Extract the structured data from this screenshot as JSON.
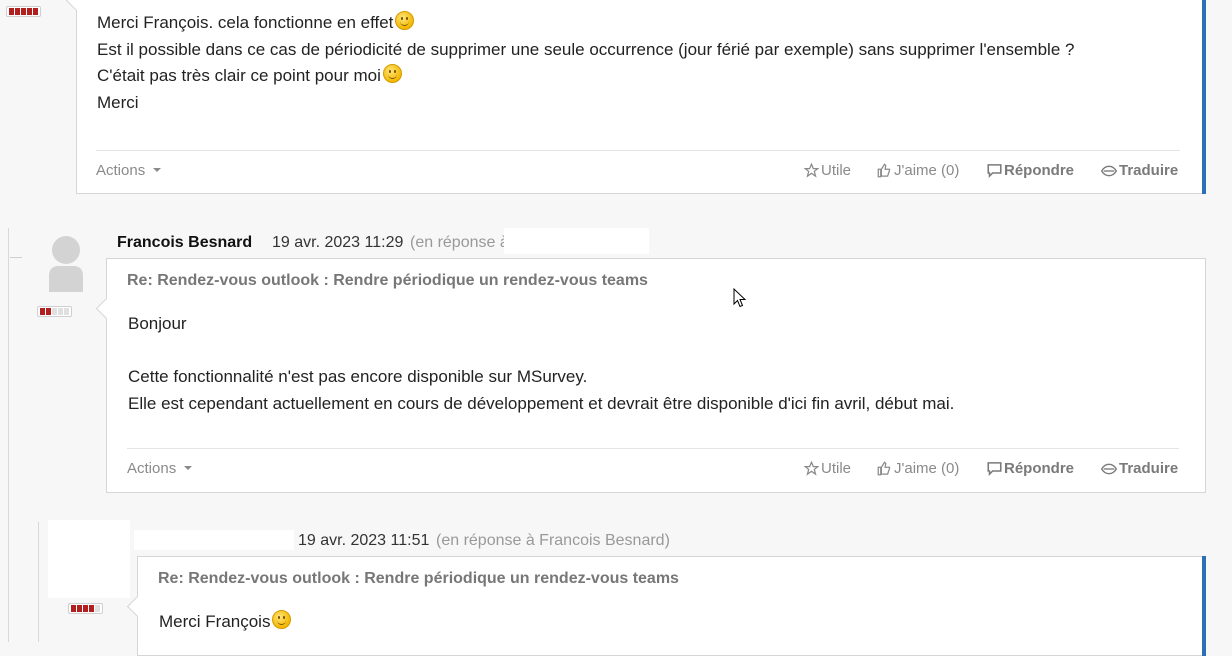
{
  "post1": {
    "body_lines": [
      "Merci François. cela fonctionne en effet",
      "Est il possible dans ce cas de périodicité de supprimer une seule occurrence (jour férié par exemple) sans supprimer l'ensemble ?",
      "C'était pas très clair ce point pour moi",
      "Merci"
    ],
    "actions_label": "Actions",
    "useful_label": "Utile",
    "like_label": "J'aime (0)",
    "reply_label": "Répondre",
    "translate_label": "Traduire"
  },
  "post2": {
    "author": "Francois Besnard",
    "date": "19 avr. 2023 11:29",
    "in_reply": "(en réponse à",
    "subject": "Re: Rendez-vous outlook : Rendre périodique un rendez-vous teams",
    "body_lines": [
      "Bonjour",
      "",
      "Cette fonctionnalité n'est pas encore disponible sur MSurvey.",
      "Elle est cependant actuellement en cours de développement et devrait être disponible d'ici fin avril, début mai."
    ],
    "actions_label": "Actions",
    "useful_label": "Utile",
    "like_label": "J'aime (0)",
    "reply_label": "Répondre",
    "translate_label": "Traduire"
  },
  "post3": {
    "date": "19 avr. 2023 11:51",
    "in_reply": "(en réponse à Francois Besnard)",
    "subject": "Re: Rendez-vous outlook : Rendre périodique un rendez-vous teams",
    "body_first_line": "Merci François"
  },
  "icons": {
    "useful": "star-icon",
    "like": "thumbs-up-icon",
    "reply": "speech-bubble-icon",
    "translate": "eye-icon",
    "smiley": "smiley-icon"
  },
  "colors": {
    "rank_active": "#b21f1f",
    "accent": "#2c6fb7",
    "muted": "#8a8a8a"
  }
}
